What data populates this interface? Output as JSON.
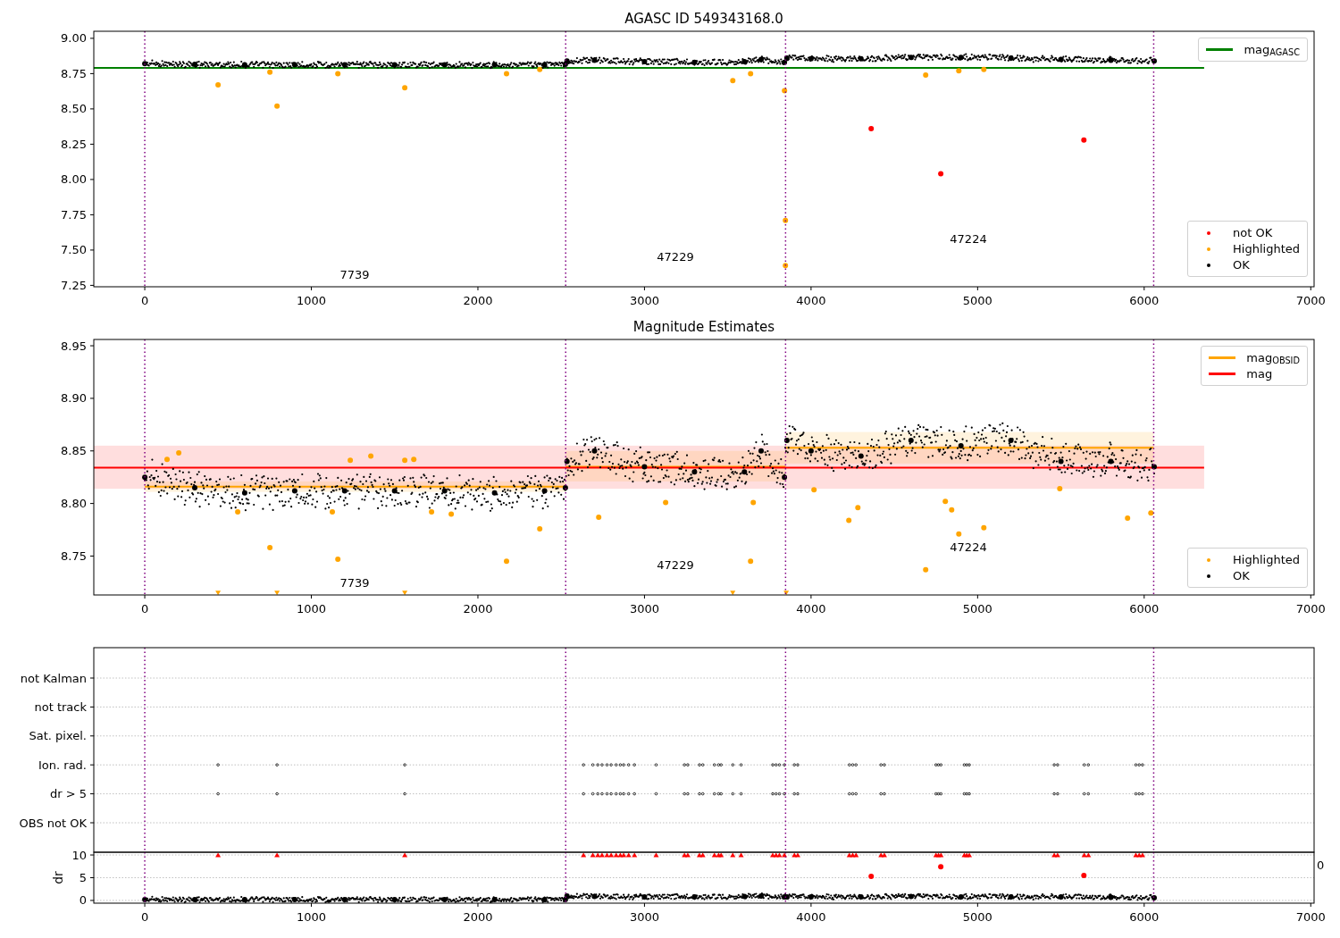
{
  "charts": [
    {
      "chart_data": {
        "type": "scatter",
        "title": "AGASC ID 549343168.0",
        "xlim": [
          -306,
          7020
        ],
        "ylim": [
          7.24,
          9.05
        ],
        "xticks": [
          0,
          1000,
          2000,
          3000,
          4000,
          5000,
          6000,
          7000
        ],
        "yticks": [
          {
            "value": 7.25,
            "label": "7.25"
          },
          {
            "value": 7.5,
            "label": "7.50"
          },
          {
            "value": 7.75,
            "label": "7.75"
          },
          {
            "value": 8.0,
            "label": "8.00"
          },
          {
            "value": 8.25,
            "label": "8.25"
          },
          {
            "value": 8.5,
            "label": "8.50"
          },
          {
            "value": 8.75,
            "label": "8.75"
          },
          {
            "value": 9.0,
            "label": "9.00"
          }
        ],
        "series": [
          {
            "name": "mag$_{AGASC}$",
            "type": "line",
            "color": "#008000",
            "x": [
              -306,
              6360
            ],
            "values": [
              8.79,
              8.79
            ]
          },
          {
            "name": "not OK",
            "color": "#ff0000",
            "x": [
              4361,
              4779,
              5638
            ],
            "values": [
              8.36,
              8.04,
              8.28
            ]
          },
          {
            "name": "Highlighted",
            "color": "#ffa500",
            "x": [
              440,
              751,
              794,
              1159,
              1561,
              2172,
              2371,
              3530,
              3637,
              3841,
              3846,
              3846,
              4688,
              4887,
              5037
            ],
            "values": [
              8.67,
              8.76,
              8.52,
              8.75,
              8.65,
              8.75,
              8.78,
              8.7,
              8.75,
              8.63,
              7.71,
              7.39,
              8.74,
              8.77,
              8.78
            ]
          },
          {
            "name": "OK",
            "color": "#000000",
            "marker": "circle",
            "x": [
              0,
              300,
              600,
              900,
              1200,
              1500,
              1800,
              2100,
              2400,
              2525,
              2535,
              2700,
              3000,
              3300,
              3600,
              3700,
              3840,
              3855,
              4000,
              4300,
              4600,
              4900,
              5200,
              5500,
              5800,
              6060
            ],
            "values": [
              8.82,
              8.815,
              8.813,
              8.812,
              8.813,
              8.813,
              8.812,
              8.812,
              8.813,
              8.815,
              8.84,
              8.845,
              8.835,
              8.83,
              8.835,
              8.85,
              8.83,
              8.86,
              8.855,
              8.855,
              8.865,
              8.865,
              8.86,
              8.85,
              8.845,
              8.84
            ]
          }
        ],
        "ref_lines": [
          {
            "axis": "x",
            "value": 0,
            "color": "#800080"
          },
          {
            "axis": "x",
            "value": 2527,
            "color": "#800080"
          },
          {
            "axis": "x",
            "value": 3847,
            "color": "#800080"
          },
          {
            "axis": "x",
            "value": 6057,
            "color": "#800080"
          }
        ],
        "annotations": [
          "7739",
          "47229",
          "47224"
        ]
      }
    },
    {
      "chart_data": {
        "type": "scatter",
        "title": "Magnitude Estimates",
        "xlim": [
          -306,
          7020
        ],
        "ylim": [
          8.713,
          8.956
        ],
        "xticks": [
          0,
          1000,
          2000,
          3000,
          4000,
          5000,
          6000,
          7000
        ],
        "yticks": [
          {
            "value": 8.75,
            "label": "8.75"
          },
          {
            "value": 8.8,
            "label": "8.80"
          },
          {
            "value": 8.85,
            "label": "8.85"
          },
          {
            "value": 8.9,
            "label": "8.90"
          },
          {
            "value": 8.95,
            "label": "8.95"
          }
        ],
        "bands": [
          {
            "axis": "y",
            "from": 8.814,
            "to": 8.855,
            "color": "#ff0000"
          },
          {
            "axis": "y",
            "from": 8.811,
            "to": 8.821,
            "color": "#ffa500"
          },
          {
            "axis": "y",
            "from": 8.821,
            "to": 8.85,
            "color": "#ffa500"
          },
          {
            "axis": "y",
            "from": 8.838,
            "to": 8.868,
            "color": "#ffa500"
          }
        ],
        "series": [
          {
            "name": "mag$_{OBSID}$",
            "type": "line",
            "color": "#ffa500",
            "x": [
              0,
              2527,
              null,
              2527,
              3847,
              null,
              3847,
              6057
            ],
            "values": [
              8.816,
              8.816,
              null,
              8.835,
              8.835,
              null,
              8.853,
              8.853
            ]
          },
          {
            "name": "mag",
            "type": "line",
            "color": "#ff0000",
            "x": [
              -306,
              6360
            ],
            "values": [
              8.834,
              8.834
            ]
          },
          {
            "name": "Highlighted",
            "color": "#ffa500",
            "x": [
              134,
              204,
              558,
              751,
              1126,
              1159,
              1234,
              1357,
              1561,
              1615,
              1722,
              1840,
              2172,
              2371,
              2725,
              3127,
              3637,
              3653,
              4018,
              4227,
              4281,
              4688,
              4806,
              4844,
              4887,
              5037,
              5493,
              5900,
              6040
            ],
            "values": [
              8.842,
              8.848,
              8.792,
              8.758,
              8.792,
              8.747,
              8.841,
              8.845,
              8.841,
              8.842,
              8.792,
              8.79,
              8.745,
              8.776,
              8.787,
              8.801,
              8.745,
              8.801,
              8.813,
              8.784,
              8.796,
              8.737,
              8.802,
              8.794,
              8.771,
              8.777,
              8.814,
              8.786,
              8.791
            ]
          },
          {
            "color": "#ffa500",
            "marker": "triangle",
            "x": [
              440,
              794,
              1561,
              3530,
              3851
            ],
            "values": [
              8.715,
              8.715,
              8.715,
              8.715,
              8.715
            ]
          },
          {
            "name": "OK",
            "color": "#000000",
            "marker": "circle",
            "x": [
              0,
              300,
              600,
              900,
              1200,
              1500,
              1800,
              2100,
              2400,
              2525,
              2535,
              2700,
              3000,
              3300,
              3600,
              3700,
              3840,
              3855,
              4000,
              4300,
              4600,
              4900,
              5200,
              5500,
              5800,
              6060
            ],
            "values": [
              8.825,
              8.815,
              8.81,
              8.812,
              8.812,
              8.812,
              8.812,
              8.81,
              8.812,
              8.815,
              8.84,
              8.85,
              8.835,
              8.83,
              8.83,
              8.85,
              8.825,
              8.86,
              8.85,
              8.845,
              8.86,
              8.855,
              8.86,
              8.84,
              8.84,
              8.835
            ]
          }
        ],
        "ref_lines": [
          {
            "axis": "x",
            "value": 0,
            "color": "#800080"
          },
          {
            "axis": "x",
            "value": 2527,
            "color": "#800080"
          },
          {
            "axis": "x",
            "value": 3847,
            "color": "#800080"
          },
          {
            "axis": "x",
            "value": 6057,
            "color": "#800080"
          }
        ],
        "annotations": [
          "7739",
          "47229",
          "47224"
        ]
      }
    },
    {
      "chart_data": {
        "type": "scatter",
        "orientation": "horizontal",
        "grid": true,
        "xlim": [
          -306,
          7020
        ],
        "categories": [
          "not Kalman",
          "not track",
          "Sat. pixel.",
          "Ion. rad.",
          "dr > 5",
          "OBS not OK"
        ],
        "series": [
          {
            "color": "#000000",
            "values": [
              null,
              null,
              null,
              440,
              440,
              null
            ]
          },
          {
            "color": "#000000",
            "values": [
              null,
              null,
              null,
              794,
              794,
              null
            ]
          },
          {
            "color": "#000000",
            "values": [
              null,
              null,
              null,
              1561,
              1561,
              null
            ]
          },
          {
            "color": "#000000",
            "values": [
              null,
              null,
              null,
              2634,
              2634,
              null
            ]
          },
          {
            "color": "#000000",
            "values": [
              null,
              null,
              null,
              2690,
              2690,
              null
            ]
          },
          {
            "color": "#000000",
            "values": [
              null,
              null,
              null,
              2720,
              2720,
              null
            ]
          },
          {
            "color": "#000000",
            "values": [
              null,
              null,
              null,
              2745,
              2745,
              null
            ]
          },
          {
            "color": "#000000",
            "values": [
              null,
              null,
              null,
              2775,
              2775,
              null
            ]
          },
          {
            "color": "#000000",
            "values": [
              null,
              null,
              null,
              2800,
              2800,
              null
            ]
          },
          {
            "color": "#000000",
            "values": [
              null,
              null,
              null,
              2830,
              2830,
              null
            ]
          },
          {
            "color": "#000000",
            "values": [
              null,
              null,
              null,
              2855,
              2855,
              null
            ]
          },
          {
            "color": "#000000",
            "values": [
              null,
              null,
              null,
              2875,
              2875,
              null
            ]
          },
          {
            "color": "#000000",
            "values": [
              null,
              null,
              null,
              2905,
              2905,
              null
            ]
          },
          {
            "color": "#000000",
            "values": [
              null,
              null,
              null,
              2940,
              2940,
              null
            ]
          },
          {
            "color": "#000000",
            "values": [
              null,
              null,
              null,
              3070,
              3070,
              null
            ]
          },
          {
            "color": "#000000",
            "values": [
              null,
              null,
              null,
              3240,
              3240,
              null
            ]
          },
          {
            "color": "#000000",
            "values": [
              null,
              null,
              null,
              3260,
              3260,
              null
            ]
          },
          {
            "color": "#000000",
            "values": [
              null,
              null,
              null,
              3330,
              3330,
              null
            ]
          },
          {
            "color": "#000000",
            "values": [
              null,
              null,
              null,
              3350,
              3350,
              null
            ]
          },
          {
            "color": "#000000",
            "values": [
              null,
              null,
              null,
              3420,
              3420,
              null
            ]
          },
          {
            "color": "#000000",
            "values": [
              null,
              null,
              null,
              3445,
              3445,
              null
            ]
          },
          {
            "color": "#000000",
            "values": [
              null,
              null,
              null,
              3460,
              3460,
              null
            ]
          },
          {
            "color": "#000000",
            "values": [
              null,
              null,
              null,
              3530,
              3530,
              null
            ]
          },
          {
            "color": "#000000",
            "values": [
              null,
              null,
              null,
              3580,
              3580,
              null
            ]
          },
          {
            "color": "#000000",
            "values": [
              null,
              null,
              null,
              3770,
              3770,
              null
            ]
          },
          {
            "color": "#000000",
            "values": [
              null,
              null,
              null,
              3790,
              3790,
              null
            ]
          },
          {
            "color": "#000000",
            "values": [
              null,
              null,
              null,
              3810,
              3810,
              null
            ]
          },
          {
            "color": "#000000",
            "values": [
              null,
              null,
              null,
              3840,
              3840,
              null
            ]
          },
          {
            "color": "#000000",
            "values": [
              null,
              null,
              null,
              3900,
              3900,
              null
            ]
          },
          {
            "color": "#000000",
            "values": [
              null,
              null,
              null,
              3920,
              3920,
              null
            ]
          },
          {
            "color": "#000000",
            "values": [
              null,
              null,
              null,
              4230,
              4230,
              null
            ]
          },
          {
            "color": "#000000",
            "values": [
              null,
              null,
              null,
              4250,
              4250,
              null
            ]
          },
          {
            "color": "#000000",
            "values": [
              null,
              null,
              null,
              4270,
              4270,
              null
            ]
          },
          {
            "color": "#000000",
            "values": [
              null,
              null,
              null,
              4420,
              4420,
              null
            ]
          },
          {
            "color": "#000000",
            "values": [
              null,
              null,
              null,
              4440,
              4440,
              null
            ]
          },
          {
            "color": "#000000",
            "values": [
              null,
              null,
              null,
              4750,
              4750,
              null
            ]
          },
          {
            "color": "#000000",
            "values": [
              null,
              null,
              null,
              4765,
              4765,
              null
            ]
          },
          {
            "color": "#000000",
            "values": [
              null,
              null,
              null,
              4780,
              4780,
              null
            ]
          },
          {
            "color": "#000000",
            "values": [
              null,
              null,
              null,
              4920,
              4920,
              null
            ]
          },
          {
            "color": "#000000",
            "values": [
              null,
              null,
              null,
              4935,
              4935,
              null
            ]
          },
          {
            "color": "#000000",
            "values": [
              null,
              null,
              null,
              4950,
              4950,
              null
            ]
          },
          {
            "color": "#000000",
            "values": [
              null,
              null,
              null,
              5460,
              5460,
              null
            ]
          },
          {
            "color": "#000000",
            "values": [
              null,
              null,
              null,
              5480,
              5480,
              null
            ]
          },
          {
            "color": "#000000",
            "values": [
              null,
              null,
              null,
              5640,
              5640,
              null
            ]
          },
          {
            "color": "#000000",
            "values": [
              null,
              null,
              null,
              5665,
              5665,
              null
            ]
          },
          {
            "color": "#000000",
            "values": [
              null,
              null,
              null,
              5950,
              5950,
              null
            ]
          },
          {
            "color": "#000000",
            "values": [
              null,
              null,
              null,
              5970,
              5970,
              null
            ]
          },
          {
            "color": "#000000",
            "values": [
              null,
              null,
              null,
              5990,
              5990,
              null
            ]
          }
        ],
        "ref_lines": [
          {
            "axis": "x",
            "value": 0,
            "color": "#800080"
          },
          {
            "axis": "x",
            "value": 2527,
            "color": "#800080"
          },
          {
            "axis": "x",
            "value": 3847,
            "color": "#800080"
          },
          {
            "axis": "x",
            "value": 6057,
            "color": "#800080"
          }
        ]
      }
    },
    {
      "chart_data": {
        "type": "scatter",
        "ylabel": "dr",
        "grid": true,
        "xlim": [
          -306,
          7020
        ],
        "ylim": [
          -0.6,
          10.6
        ],
        "xticks": [
          0,
          1000,
          2000,
          3000,
          4000,
          5000,
          6000,
          7000
        ],
        "yticks": [
          0,
          5,
          10
        ],
        "series": [
          {
            "color": "#000000",
            "marker": "circle",
            "x": [
              0,
              300,
              600,
              900,
              1200,
              1500,
              1800,
              2100,
              2400,
              2525,
              2535,
              2700,
              3000,
              3300,
              3600,
              3700,
              3840,
              3855,
              4000,
              4300,
              4600,
              4900,
              5200,
              5500,
              5800,
              6060
            ],
            "values": [
              0.2,
              0.2,
              0.2,
              0.2,
              0.2,
              0.2,
              0.2,
              0.2,
              0.2,
              0.2,
              1.0,
              0.9,
              0.8,
              0.8,
              0.9,
              1.0,
              0.8,
              0.8,
              0.8,
              0.8,
              0.9,
              0.8,
              0.8,
              0.8,
              0.7,
              0.6
            ]
          },
          {
            "color": "#ff0000",
            "marker": "triangle",
            "x": [
              440,
              794,
              1561,
              2634,
              2690,
              2720,
              2745,
              2775,
              2800,
              2830,
              2855,
              2875,
              2905,
              2940,
              3070,
              3240,
              3260,
              3330,
              3350,
              3420,
              3445,
              3460,
              3530,
              3580,
              3770,
              3790,
              3810,
              3840,
              3900,
              3920,
              4230,
              4250,
              4270,
              4420,
              4440,
              4750,
              4765,
              4780,
              4920,
              4935,
              4950,
              5460,
              5480,
              5640,
              5665,
              5950,
              5970,
              5990
            ],
            "values": [
              10,
              10,
              10,
              10,
              10,
              10,
              10,
              10,
              10,
              10,
              10,
              10,
              10,
              10,
              10,
              10,
              10,
              10,
              10,
              10,
              10,
              10,
              10,
              10,
              10,
              10,
              10,
              10,
              10,
              10,
              10,
              10,
              10,
              10,
              10,
              10,
              10,
              10,
              10,
              10,
              10,
              10,
              10,
              10,
              10,
              10,
              10,
              10
            ]
          },
          {
            "color": "#ff0000",
            "x": [
              4361,
              4779,
              5638
            ],
            "values": [
              5.3,
              7.4,
              5.5
            ]
          }
        ],
        "ref_lines": [
          {
            "axis": "x",
            "value": 0,
            "color": "#800080"
          },
          {
            "axis": "x",
            "value": 2527,
            "color": "#800080"
          },
          {
            "axis": "x",
            "value": 3847,
            "color": "#800080"
          },
          {
            "axis": "x",
            "value": 6057,
            "color": "#800080"
          }
        ]
      }
    }
  ],
  "cut_off_label": "0"
}
